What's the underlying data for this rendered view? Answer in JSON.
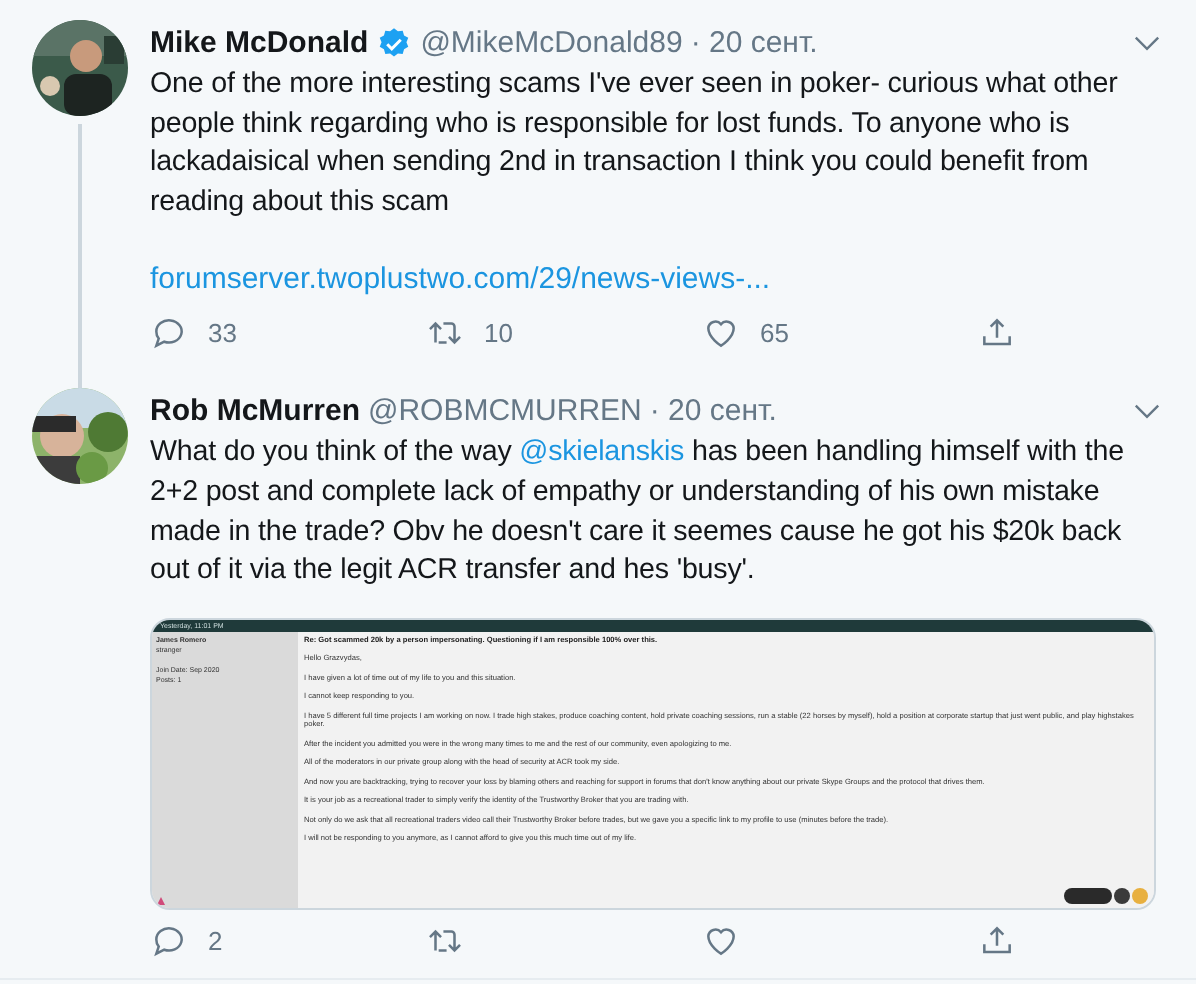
{
  "tweets": [
    {
      "name": "Mike McDonald",
      "verified": true,
      "handle": "@MikeMcDonald89",
      "date": "· 20 сент.",
      "thread_line": true,
      "text": [
        {
          "kind": "plain",
          "text": "One of the more interesting scams I've ever seen in poker- curious what other people think regarding who is responsible for lost funds. To anyone who is lackadaisical when sending 2nd in transaction I think you could benefit from reading about this scam"
        }
      ],
      "link": "forumserver.twoplustwo.com/29/news-views-...",
      "counts": {
        "reply": "33",
        "retweet": "10",
        "like": "65"
      }
    },
    {
      "name": "Rob McMurren",
      "verified": false,
      "handle": "@ROBMCMURREN",
      "date": "· 20 сент.",
      "thread_line": false,
      "text": [
        {
          "kind": "plain",
          "text": "What do you think of the way "
        },
        {
          "kind": "mention",
          "text": "@skielanskis"
        },
        {
          "kind": "plain",
          "text": " has been handling himself with the 2+2 post and complete lack of empathy or understanding of his own mistake made in the trade? Obv he doesn't care it seemes cause he got his $20k back out of it via the legit ACR transfer and hes 'busy'."
        }
      ],
      "embedded_post": {
        "date": "Yesterday, 11:01 PM",
        "author": "James Romero",
        "role": "stranger",
        "join_date": "Join Date: Sep 2020",
        "posts": "Posts: 1",
        "title": "Re: Got scammed 20k by a person impersonating. Questioning if I am responsible 100% over this.",
        "paragraphs": [
          "Hello Grazvydas,",
          "I have given a lot of time out of my life to you and this situation.",
          "I cannot keep responding to you.",
          "I have 5 different full time projects I am working on now. I trade high stakes, produce coaching content, hold private coaching sessions, run a stable (22 horses by myself), hold a position at corporate startup that just went public, and play highstakes poker.",
          "After the incident you admitted you were in the wrong many times to me and the rest of our community, even apologizing to me.",
          "All of the moderators in our private group along with the head of security at ACR took my side.",
          "And now you are backtracking, trying to recover your loss by blaming others and reaching for support in forums that don't know anything about our private Skype Groups and the protocol that drives them.",
          "It is your job as a recreational trader to simply verify the identity of the Trustworthy Broker that you are trading with.",
          "Not only do we ask that all recreational traders video call their Trustworthy Broker before trades, but we gave you a specific link to my profile to use (minutes before the trade).",
          "I will not be responding to you anymore, as I cannot afford to give you this much time out of my life."
        ]
      },
      "counts": {
        "reply": "2"
      }
    }
  ]
}
